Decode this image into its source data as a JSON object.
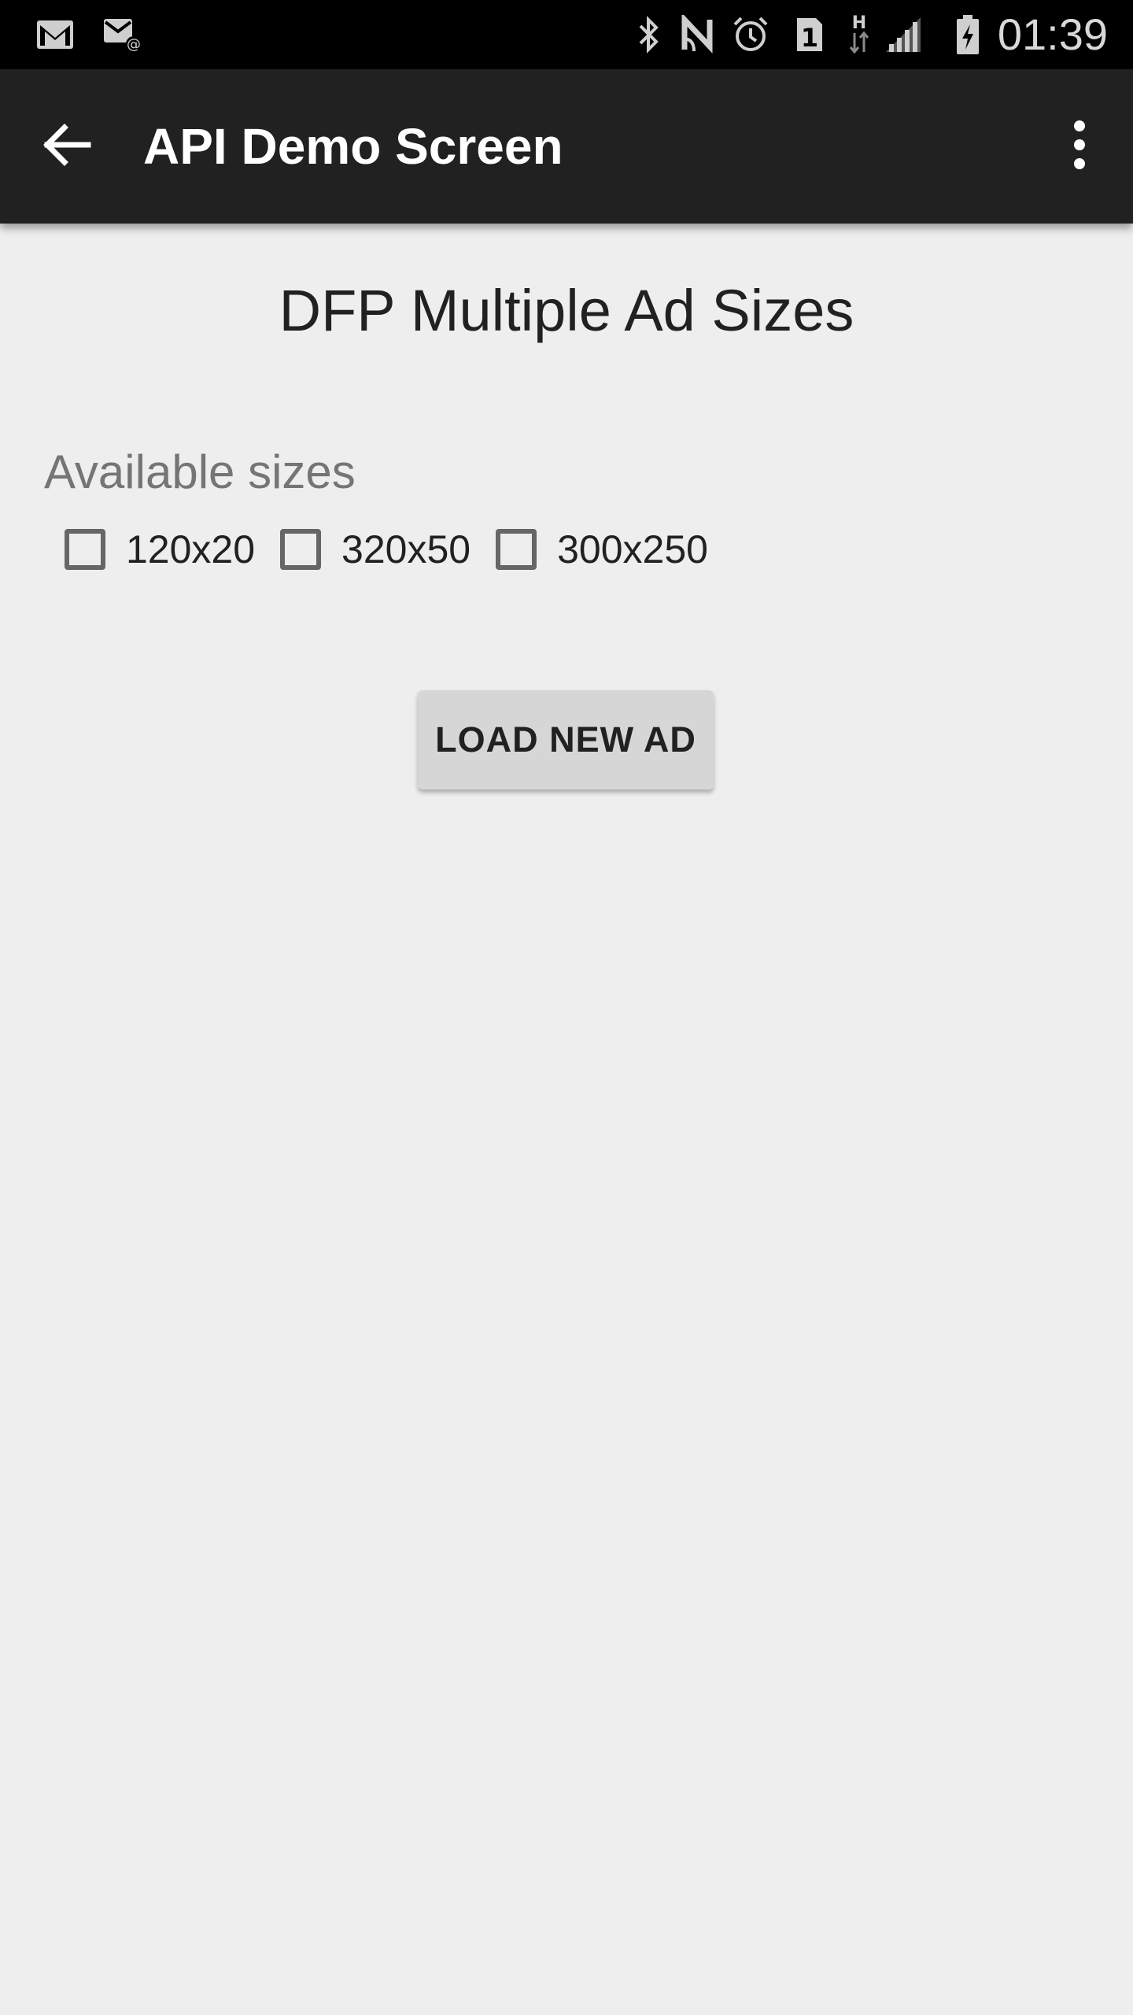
{
  "status_bar": {
    "time": "01:39",
    "left_icons": [
      "gmail-icon",
      "email-icon"
    ],
    "right_icons": [
      "bluetooth-icon",
      "nfc-icon",
      "alarm-icon",
      "sim-1-icon",
      "h-data-icon",
      "signal-icon",
      "battery-charging-icon"
    ]
  },
  "app_bar": {
    "title": "API Demo Screen",
    "back_icon": "arrow-back-icon",
    "menu_icon": "more-vert-icon",
    "background": "#212121"
  },
  "content": {
    "heading": "DFP Multiple Ad Sizes",
    "sizes_label": "Available sizes",
    "sizes": [
      {
        "label": "120x20",
        "checked": false
      },
      {
        "label": "320x50",
        "checked": false
      },
      {
        "label": "300x250",
        "checked": false
      }
    ],
    "load_button": "LOAD NEW AD"
  }
}
